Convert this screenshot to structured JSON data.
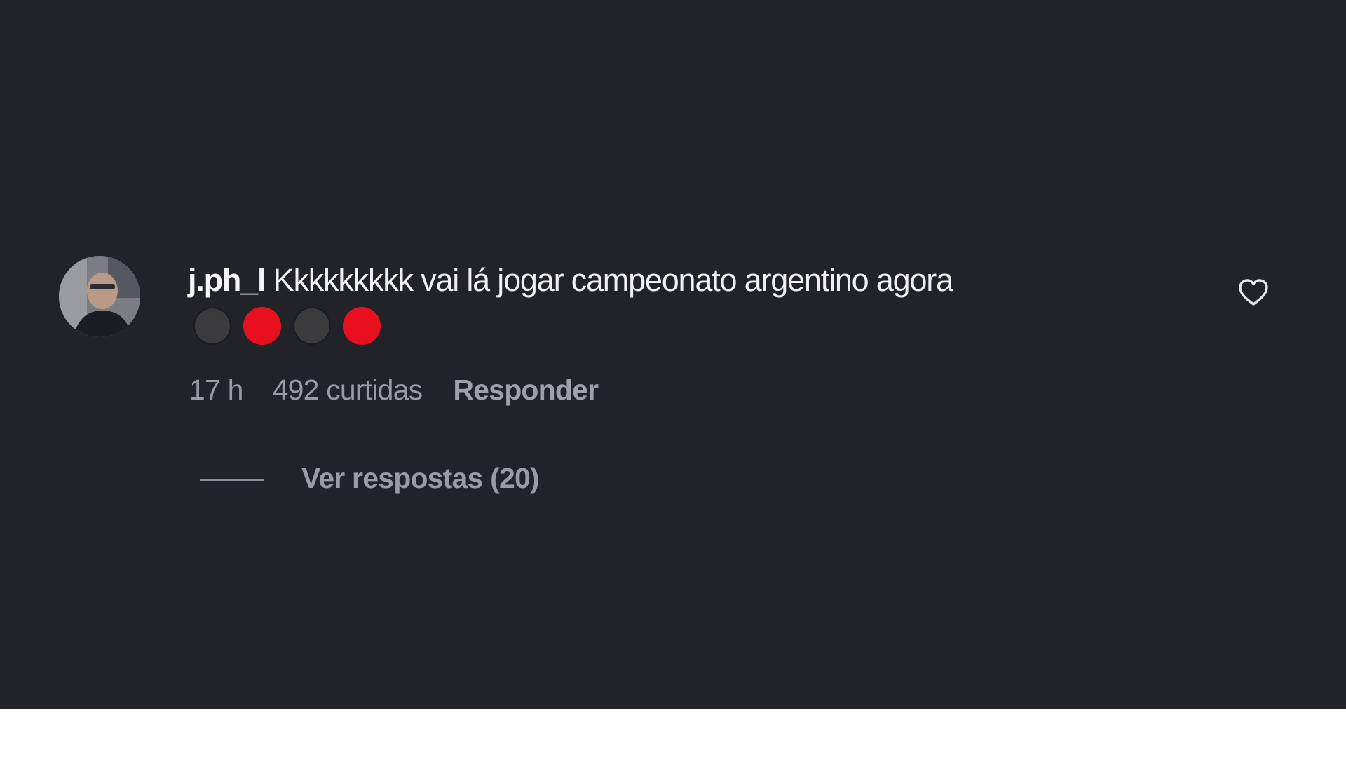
{
  "comment": {
    "username": "j.ph_l",
    "text": "Kkkkkkkkk vai lá jogar campeonato argentino agora",
    "emojis": [
      {
        "icon": "black-circle-emoji",
        "color": "#3b3b3d"
      },
      {
        "icon": "red-circle-emoji",
        "color": "#e8101e"
      },
      {
        "icon": "black-circle-emoji",
        "color": "#3b3b3d"
      },
      {
        "icon": "red-circle-emoji",
        "color": "#e8101e"
      }
    ],
    "time": "17 h",
    "likes": "492 curtidas",
    "reply_label": "Responder",
    "view_replies_label": "Ver respostas (20)",
    "like_icon": "heart-outline-icon"
  },
  "colors": {
    "background": "#222329",
    "text_primary": "#f2f2f4",
    "text_secondary": "#9a9ba3"
  }
}
